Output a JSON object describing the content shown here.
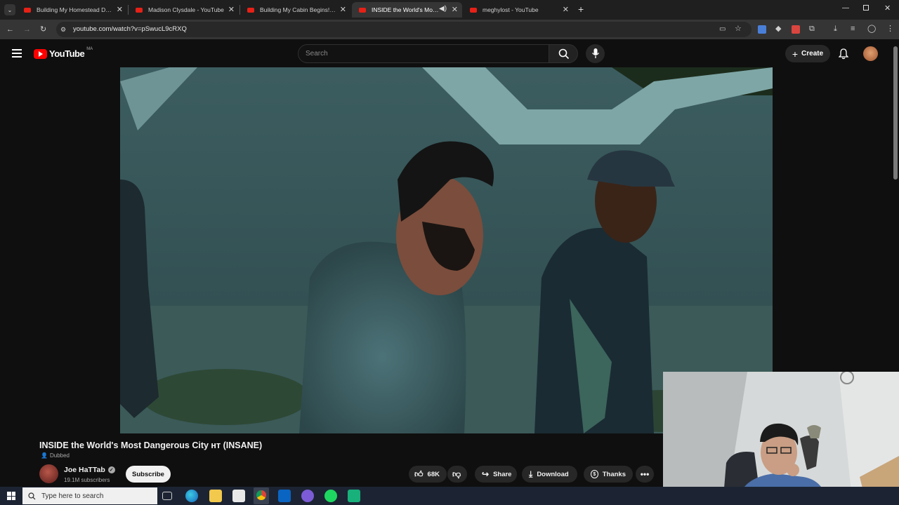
{
  "browser": {
    "tabs": [
      {
        "title": "Building My Homestead Deck L",
        "active": false
      },
      {
        "title": "Madison Clysdale - YouTube",
        "active": false
      },
      {
        "title": "Building My Cabin Begins! Dig",
        "active": false
      },
      {
        "title": "INSIDE the World's Most D",
        "active": true
      },
      {
        "title": "meghylost - YouTube",
        "active": false
      }
    ],
    "url": "youtube.com/watch?v=pSwucL9cRXQ"
  },
  "youtube": {
    "logo_text": "YouTube",
    "country_code": "MA",
    "search_placeholder": "Search",
    "create_label": "Create"
  },
  "video": {
    "title": "INSIDE the World's Most Dangerous City ʜᴛ (INSANE)",
    "dubbed_label": "Dubbed",
    "channel_name": "Joe HaTTab",
    "subscribers": "19.1M subscribers",
    "subscribe_label": "Subscribe",
    "likes": "68K",
    "share_label": "Share",
    "download_label": "Download",
    "thanks_label": "Thanks"
  },
  "taskbar": {
    "search_placeholder": "Type here to search"
  },
  "colors": {
    "youtube_red": "#ff0000",
    "tab_favicon": "#e62117",
    "accent_blue": "#3ea6ff"
  }
}
